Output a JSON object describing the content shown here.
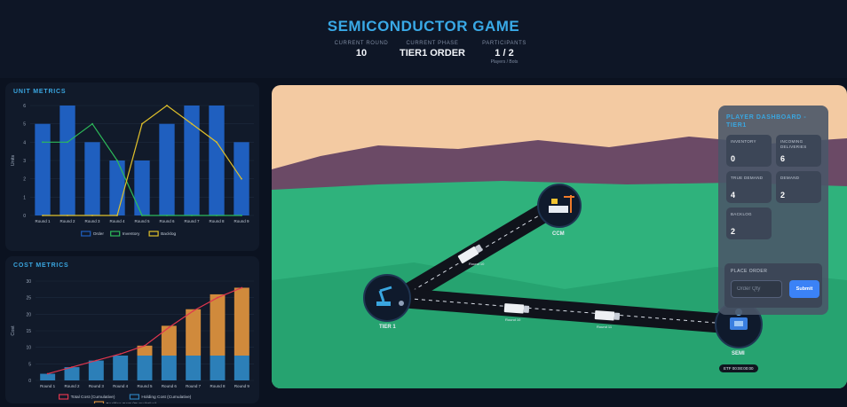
{
  "header": {
    "title": "SEMICONDUCTOR GAME",
    "round_label": "CURRENT ROUND",
    "round_value": "10",
    "phase_label": "CURRENT PHASE",
    "phase_value": "TIER1 ORDER",
    "participants_label": "PARTICIPANTS",
    "participants_value": "1 / 2",
    "participants_sub": "Players / Bots"
  },
  "unit_metrics": {
    "title": "UNIT METRICS",
    "colors": {
      "order": "#1f5fbf",
      "inventory": "#2dbb5a",
      "backlog": "#e0c02a"
    }
  },
  "cost_metrics": {
    "title": "COST METRICS",
    "colors": {
      "total": "#e0364e",
      "holding": "#2c7fb8",
      "backlog": "#d08a3c"
    }
  },
  "chart_data": [
    {
      "type": "bar",
      "title": "UNIT METRICS",
      "ylabel": "Units",
      "ylim": [
        0,
        6
      ],
      "yticks": [
        0,
        1,
        2,
        3,
        4,
        5,
        6
      ],
      "categories": [
        "Round 1",
        "Round 2",
        "Round 3",
        "Round 4",
        "Round 5",
        "Round 6",
        "Round 7",
        "Round 8",
        "Round 9"
      ],
      "series": [
        {
          "name": "Order",
          "kind": "bar",
          "values": [
            5,
            6,
            4,
            3,
            3,
            5,
            6,
            6,
            4
          ]
        },
        {
          "name": "Inventory",
          "kind": "line",
          "values": [
            4,
            4,
            5,
            3,
            0,
            0,
            0,
            0,
            0
          ]
        },
        {
          "name": "Backlog",
          "kind": "line",
          "values": [
            0,
            0,
            0,
            0,
            5,
            6,
            5,
            4,
            2
          ]
        }
      ],
      "legend": "bottom"
    },
    {
      "type": "bar",
      "title": "COST METRICS",
      "ylabel": "Cost",
      "ylim": [
        0,
        30
      ],
      "yticks": [
        0,
        5,
        10,
        15,
        20,
        25,
        30
      ],
      "categories": [
        "Round 1",
        "Round 2",
        "Round 3",
        "Round 4",
        "Round 5",
        "Round 6",
        "Round 7",
        "Round 8",
        "Round 9"
      ],
      "series": [
        {
          "name": "Total Cost (Cumulative)",
          "kind": "line",
          "values": [
            2,
            4,
            6,
            8,
            10.5,
            16,
            21,
            25,
            28
          ]
        },
        {
          "name": "Holding Cost (Cumulative)",
          "kind": "stack",
          "values": [
            2,
            4,
            6,
            7.5,
            7.5,
            7.5,
            7.5,
            7.5,
            7.5
          ]
        },
        {
          "name": "Backlog Cost (Cumulative)",
          "kind": "stack",
          "values": [
            0,
            0,
            0,
            0,
            3,
            9,
            14,
            18.5,
            20.5
          ]
        }
      ],
      "legend": "bottom"
    }
  ],
  "scene": {
    "nodes": {
      "tier1": "TIER 1",
      "ccm": "CCM",
      "semi": "SEMI",
      "semi_badge": "ETF 00:00:00:00"
    },
    "trucks": [
      {
        "label": "Round 10",
        "count": "6"
      },
      {
        "label": "Round 10",
        "count": "3"
      },
      {
        "label": "Round 11",
        "count": "3"
      }
    ],
    "icons": [
      "robot-arm-icon",
      "factory-icon",
      "chip-icon",
      "truck-icon"
    ]
  },
  "dashboard": {
    "title": "PLAYER DASHBOARD - TIER1",
    "inventory_label": "INVENTORY",
    "inventory_value": "0",
    "incoming_label": "INCOMING DELIVERIES",
    "incoming_value": "6",
    "true_demand_label": "TRUE DEMAND",
    "true_demand_value": "4",
    "demand_label": "DEMAND",
    "demand_value": "2",
    "backlog_label": "BACKLOG",
    "backlog_value": "2",
    "order_title": "PLACE ORDER",
    "order_placeholder": "Order Qty",
    "submit_label": "Submit"
  }
}
